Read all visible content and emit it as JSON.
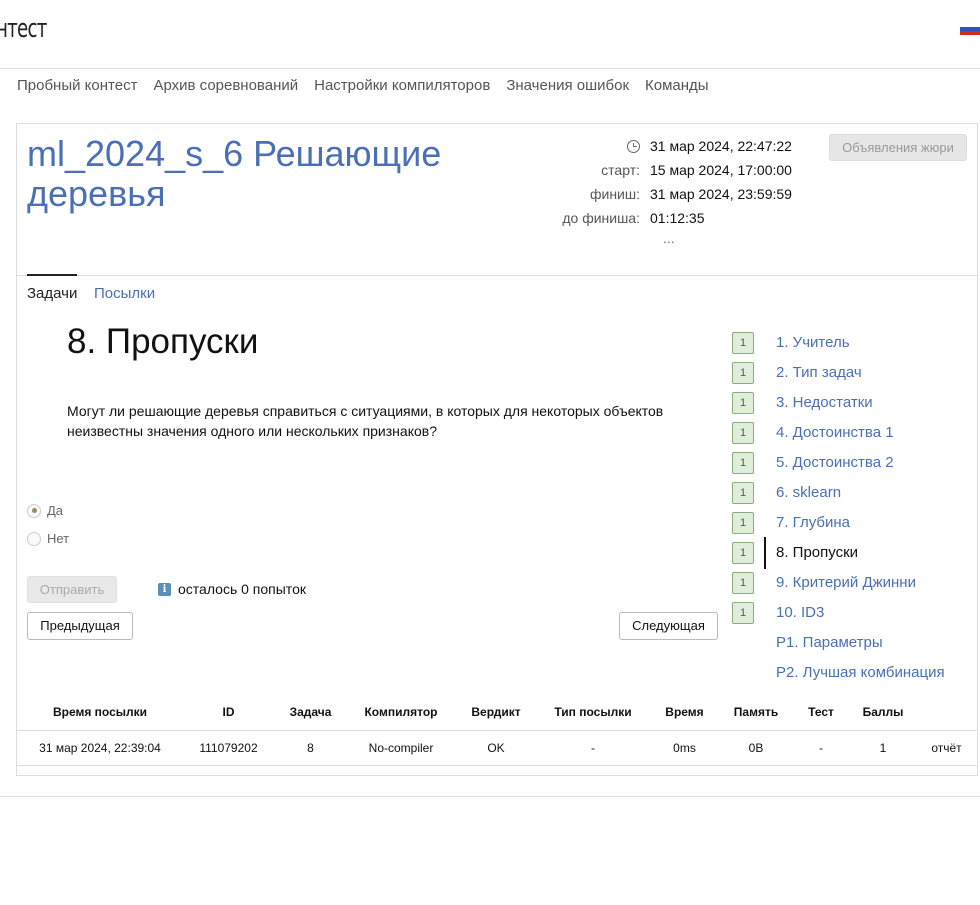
{
  "header": {
    "logo": "нтест",
    "flag_colors": [
      "#ffffff",
      "#2a55b8",
      "#d52b1e"
    ],
    "nav": [
      "Пробный контест",
      "Архив соревнований",
      "Настройки компиляторов",
      "Значения ошибок",
      "Команды"
    ]
  },
  "contest": {
    "title": "ml_2024_s_6 Решающие деревья",
    "clock_icon": "clock-icon",
    "current_time": "31 мар 2024, 22:47:22",
    "start_label": "старт:",
    "start": "15 мар 2024, 17:00:00",
    "finish_label": "финиш:",
    "finish": "31 мар 2024, 23:59:59",
    "remaining_label": "до финиша:",
    "remaining": "01:12:35",
    "more": "...",
    "jury_button": "Объявления жюри"
  },
  "tabs": {
    "tasks": "Задачи",
    "submissions": "Посылки"
  },
  "problem": {
    "title": "8. Пропуски",
    "statement": "Могут ли решающие деревья справиться с ситуациями, в которых для некоторых объектов неизвестны значения одного или нескольких признаков?",
    "options": [
      "Да",
      "Нет"
    ],
    "selected_option": "Да",
    "submit_button": "Отправить",
    "info_icon": "i",
    "attempts_left": "осталось 0 попыток",
    "prev_button": "Предыдущая",
    "next_button": "Следующая"
  },
  "problem_list": [
    {
      "badge": "1",
      "label": "1. Учитель"
    },
    {
      "badge": "1",
      "label": "2. Тип задач"
    },
    {
      "badge": "1",
      "label": "3. Недостатки"
    },
    {
      "badge": "1",
      "label": "4. Достоинства 1"
    },
    {
      "badge": "1",
      "label": "5. Достоинства 2"
    },
    {
      "badge": "1",
      "label": "6. sklearn"
    },
    {
      "badge": "1",
      "label": "7. Глубина"
    },
    {
      "badge": "1",
      "label": "8. Пропуски",
      "current": true
    },
    {
      "badge": "1",
      "label": "9. Критерий Джинни"
    },
    {
      "badge": "1",
      "label": "10. ID3"
    },
    {
      "badge": "",
      "label": "P1. Параметры"
    },
    {
      "badge": "",
      "label": "P2. Лучшая комбинация"
    }
  ],
  "submissions": {
    "headers": [
      "Время посылки",
      "ID",
      "Задача",
      "Компилятор",
      "Вердикт",
      "Тип посылки",
      "Время",
      "Память",
      "Тест",
      "Баллы",
      ""
    ],
    "rows": [
      [
        "31 мар 2024, 22:39:04",
        "111079202",
        "8",
        "No-compiler",
        "OK",
        "-",
        "0ms",
        "0B",
        "-",
        "1",
        "отчёт"
      ]
    ]
  }
}
